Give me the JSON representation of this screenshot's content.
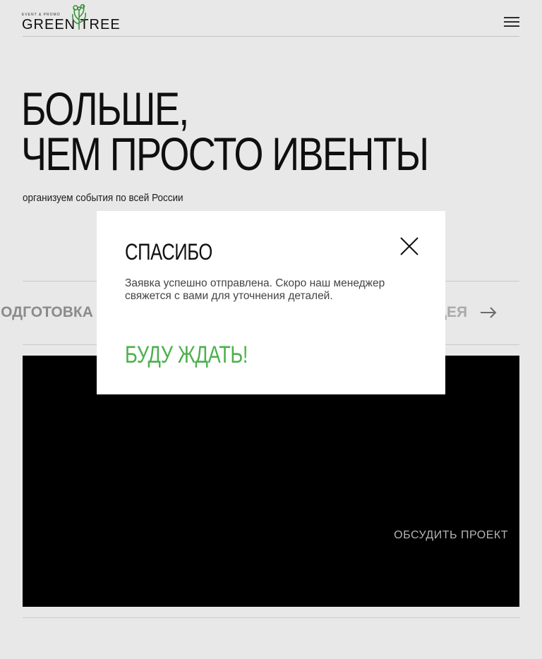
{
  "header": {
    "logo_small": "EVENT & PROMO",
    "logo_main": "GREEN TREE",
    "menu_icon": "hamburger-menu-icon"
  },
  "hero": {
    "title_line1": "БОЛЬШЕ,",
    "title_line2": "ЧЕМ ПРОСТО ИВЕНТЫ",
    "subtitle": "организуем события по всей России"
  },
  "steps": {
    "left_label": "ПОДГОТОВКА",
    "right_label": "ИДЕЯ",
    "arrow_icon": "arrow-right-icon"
  },
  "video": {
    "discuss_label": "ОБСУДИТЬ ПРОЕКТ"
  },
  "modal": {
    "title": "СПАСИБО",
    "text": "Заявка успешно отправлена. Скоро наш менеджер свяжется с вами для уточнения деталей.",
    "cta": "БУДУ ЖДАТЬ!",
    "close_icon": "close-icon"
  },
  "colors": {
    "accent_green": "#4cb04c",
    "video_bg": "#000000"
  }
}
